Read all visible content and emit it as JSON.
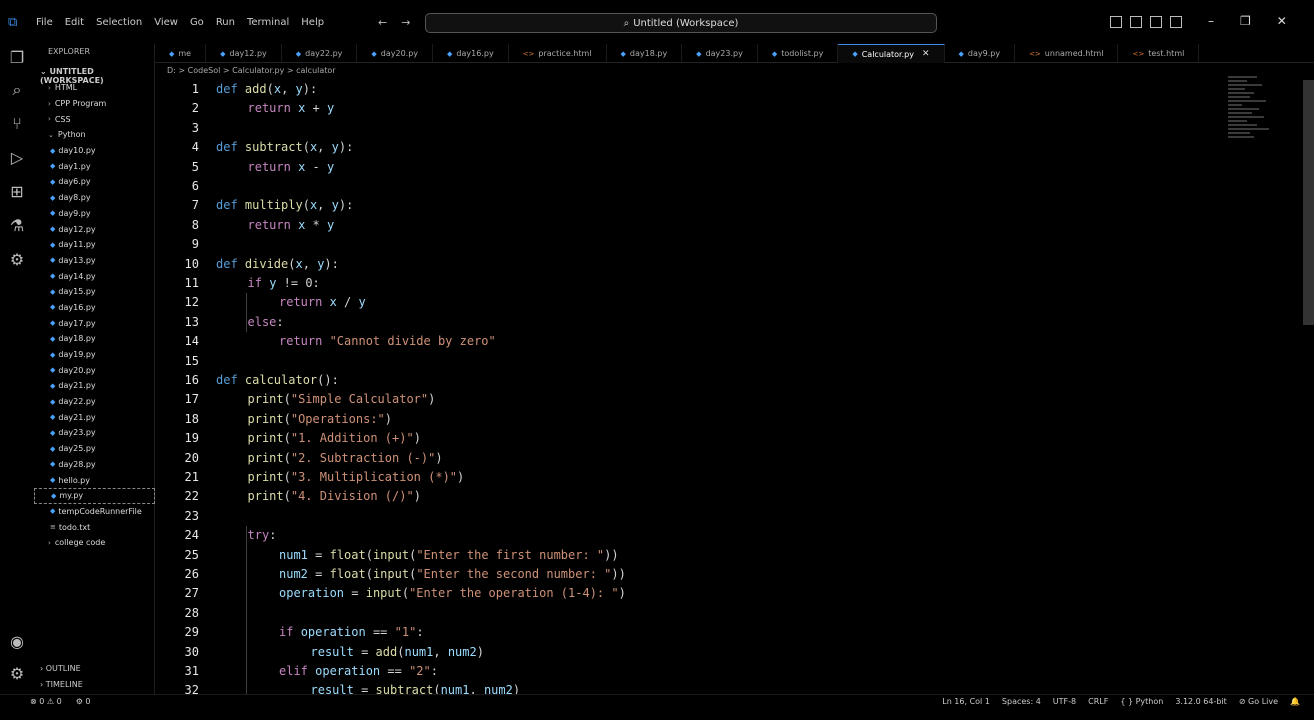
{
  "titlebar": {
    "menu": [
      "File",
      "Edit",
      "Selection",
      "View",
      "Go",
      "Run",
      "Terminal",
      "Help"
    ],
    "search_text": "Untitled (Workspace)"
  },
  "sidebar": {
    "header": "EXPLORER",
    "workspace": "UNTITLED (WORKSPACE)",
    "items": [
      {
        "label": "HTML",
        "type": "folder"
      },
      {
        "label": "CPP Program",
        "type": "folder"
      },
      {
        "label": "CSS",
        "type": "folder"
      },
      {
        "label": "Python",
        "type": "folder-open"
      },
      {
        "label": "day10.py",
        "type": "py"
      },
      {
        "label": "day1.py",
        "type": "py"
      },
      {
        "label": "day6.py",
        "type": "py"
      },
      {
        "label": "day8.py",
        "type": "py"
      },
      {
        "label": "day9.py",
        "type": "py"
      },
      {
        "label": "day12.py",
        "type": "py"
      },
      {
        "label": "day11.py",
        "type": "py"
      },
      {
        "label": "day13.py",
        "type": "py"
      },
      {
        "label": "day14.py",
        "type": "py"
      },
      {
        "label": "day15.py",
        "type": "py"
      },
      {
        "label": "day16.py",
        "type": "py"
      },
      {
        "label": "day17.py",
        "type": "py"
      },
      {
        "label": "day18.py",
        "type": "py"
      },
      {
        "label": "day19.py",
        "type": "py"
      },
      {
        "label": "day20.py",
        "type": "py"
      },
      {
        "label": "day21.py",
        "type": "py"
      },
      {
        "label": "day22.py",
        "type": "py"
      },
      {
        "label": "day21.py",
        "type": "py"
      },
      {
        "label": "day23.py",
        "type": "py"
      },
      {
        "label": "day25.py",
        "type": "py"
      },
      {
        "label": "day28.py",
        "type": "py"
      },
      {
        "label": "hello.py",
        "type": "py"
      },
      {
        "label": "my.py",
        "type": "py"
      },
      {
        "label": "tempCodeRunnerFile",
        "type": "py"
      },
      {
        "label": "todo.txt",
        "type": "file"
      },
      {
        "label": "college code",
        "type": "folder"
      }
    ],
    "outline": "OUTLINE",
    "timeline": "TIMELINE"
  },
  "tabs": [
    {
      "label": "me"
    },
    {
      "label": "day12.py"
    },
    {
      "label": "day22.py"
    },
    {
      "label": "day20.py"
    },
    {
      "label": "day16.py"
    },
    {
      "label": "practice.html"
    },
    {
      "label": "day18.py"
    },
    {
      "label": "day23.py"
    },
    {
      "label": "todolist.py"
    },
    {
      "label": "Calculator.py",
      "active": true
    },
    {
      "label": "day9.py"
    },
    {
      "label": "unnamed.html"
    },
    {
      "label": "test.html"
    }
  ],
  "breadcrumb": "D: > CodeSol > Calculator.py > calculator",
  "editor": {
    "lines": [
      {
        "n": "1",
        "indent": 0,
        "html": [
          [
            "kw",
            "def "
          ],
          [
            "fn",
            "add"
          ],
          [
            "txt",
            "("
          ],
          [
            "var",
            "x"
          ],
          [
            "txt",
            ", "
          ],
          [
            "var",
            "y"
          ],
          [
            "txt",
            "):"
          ]
        ]
      },
      {
        "n": "2",
        "indent": 1,
        "html": [
          [
            "kw2",
            "return "
          ],
          [
            "var",
            "x"
          ],
          [
            "txt",
            " + "
          ],
          [
            "var",
            "y"
          ]
        ]
      },
      {
        "n": "3",
        "indent": 0,
        "html": []
      },
      {
        "n": "4",
        "indent": 0,
        "html": [
          [
            "kw",
            "def "
          ],
          [
            "fn",
            "subtract"
          ],
          [
            "txt",
            "("
          ],
          [
            "var",
            "x"
          ],
          [
            "txt",
            ", "
          ],
          [
            "var",
            "y"
          ],
          [
            "txt",
            "):"
          ]
        ]
      },
      {
        "n": "5",
        "indent": 1,
        "html": [
          [
            "kw2",
            "return "
          ],
          [
            "var",
            "x"
          ],
          [
            "txt",
            " - "
          ],
          [
            "var",
            "y"
          ]
        ]
      },
      {
        "n": "6",
        "indent": 0,
        "html": []
      },
      {
        "n": "7",
        "indent": 0,
        "html": [
          [
            "kw",
            "def "
          ],
          [
            "fn",
            "multiply"
          ],
          [
            "txt",
            "("
          ],
          [
            "var",
            "x"
          ],
          [
            "txt",
            ", "
          ],
          [
            "var",
            "y"
          ],
          [
            "txt",
            "):"
          ]
        ]
      },
      {
        "n": "8",
        "indent": 1,
        "html": [
          [
            "kw2",
            "return "
          ],
          [
            "var",
            "x"
          ],
          [
            "txt",
            " * "
          ],
          [
            "var",
            "y"
          ]
        ]
      },
      {
        "n": "9",
        "indent": 0,
        "html": []
      },
      {
        "n": "10",
        "indent": 0,
        "html": [
          [
            "kw",
            "def "
          ],
          [
            "fn",
            "divide"
          ],
          [
            "txt",
            "("
          ],
          [
            "var",
            "x"
          ],
          [
            "txt",
            ", "
          ],
          [
            "var",
            "y"
          ],
          [
            "txt",
            "):"
          ]
        ]
      },
      {
        "n": "11",
        "indent": 1,
        "html": [
          [
            "kw2",
            "if "
          ],
          [
            "var",
            "y"
          ],
          [
            "txt",
            " != "
          ],
          [
            "txt",
            "0:"
          ]
        ]
      },
      {
        "n": "12",
        "indent": 2,
        "html": [
          [
            "kw2",
            "return "
          ],
          [
            "var",
            "x"
          ],
          [
            "txt",
            " / "
          ],
          [
            "var",
            "y"
          ]
        ]
      },
      {
        "n": "13",
        "indent": 1,
        "html": [
          [
            "kw2",
            "else"
          ],
          [
            "txt",
            ":"
          ]
        ]
      },
      {
        "n": "14",
        "indent": 2,
        "html": [
          [
            "kw2",
            "return "
          ],
          [
            "str",
            "\"Cannot divide by zero\""
          ]
        ]
      },
      {
        "n": "15",
        "indent": 0,
        "html": []
      },
      {
        "n": "16",
        "indent": 0,
        "html": [
          [
            "kw",
            "def "
          ],
          [
            "fn",
            "calculator"
          ],
          [
            "txt",
            "():"
          ]
        ]
      },
      {
        "n": "17",
        "indent": 1,
        "html": [
          [
            "fn",
            "print"
          ],
          [
            "txt",
            "("
          ],
          [
            "str",
            "\"Simple Calculator\""
          ],
          [
            "txt",
            ")"
          ]
        ]
      },
      {
        "n": "18",
        "indent": 1,
        "html": [
          [
            "fn",
            "print"
          ],
          [
            "txt",
            "("
          ],
          [
            "str",
            "\"Operations:\""
          ],
          [
            "txt",
            ")"
          ]
        ]
      },
      {
        "n": "19",
        "indent": 1,
        "html": [
          [
            "fn",
            "print"
          ],
          [
            "txt",
            "("
          ],
          [
            "str",
            "\"1. Addition (+)\""
          ],
          [
            "txt",
            ")"
          ]
        ]
      },
      {
        "n": "20",
        "indent": 1,
        "html": [
          [
            "fn",
            "print"
          ],
          [
            "txt",
            "("
          ],
          [
            "str",
            "\"2. Subtraction (-)\""
          ],
          [
            "txt",
            ")"
          ]
        ]
      },
      {
        "n": "21",
        "indent": 1,
        "html": [
          [
            "fn",
            "print"
          ],
          [
            "txt",
            "("
          ],
          [
            "str",
            "\"3. Multiplication (*)\""
          ],
          [
            "txt",
            ")"
          ]
        ]
      },
      {
        "n": "22",
        "indent": 1,
        "html": [
          [
            "fn",
            "print"
          ],
          [
            "txt",
            "("
          ],
          [
            "str",
            "\"4. Division (/)\""
          ],
          [
            "txt",
            ")"
          ]
        ]
      },
      {
        "n": "23",
        "indent": 0,
        "html": []
      },
      {
        "n": "24",
        "indent": 1,
        "html": [
          [
            "kw2",
            "try"
          ],
          [
            "txt",
            ":"
          ]
        ]
      },
      {
        "n": "25",
        "indent": 2,
        "html": [
          [
            "var",
            "num1"
          ],
          [
            "txt",
            " = "
          ],
          [
            "fn",
            "float"
          ],
          [
            "txt",
            "("
          ],
          [
            "fn",
            "input"
          ],
          [
            "txt",
            "("
          ],
          [
            "str",
            "\"Enter the first number: \""
          ],
          [
            "txt",
            "))"
          ]
        ]
      },
      {
        "n": "26",
        "indent": 2,
        "html": [
          [
            "var",
            "num2"
          ],
          [
            "txt",
            " = "
          ],
          [
            "fn",
            "float"
          ],
          [
            "txt",
            "("
          ],
          [
            "fn",
            "input"
          ],
          [
            "txt",
            "("
          ],
          [
            "str",
            "\"Enter the second number: \""
          ],
          [
            "txt",
            "))"
          ]
        ]
      },
      {
        "n": "27",
        "indent": 2,
        "html": [
          [
            "var",
            "operation"
          ],
          [
            "txt",
            " = "
          ],
          [
            "fn",
            "input"
          ],
          [
            "txt",
            "("
          ],
          [
            "str",
            "\"Enter the operation (1-4): \""
          ],
          [
            "txt",
            ")"
          ]
        ]
      },
      {
        "n": "28",
        "indent": 0,
        "html": []
      },
      {
        "n": "29",
        "indent": 2,
        "html": [
          [
            "kw2",
            "if "
          ],
          [
            "var",
            "operation"
          ],
          [
            "txt",
            " == "
          ],
          [
            "str",
            "\"1\""
          ],
          [
            "txt",
            ":"
          ]
        ]
      },
      {
        "n": "30",
        "indent": 3,
        "html": [
          [
            "var",
            "result"
          ],
          [
            "txt",
            " = "
          ],
          [
            "fn",
            "add"
          ],
          [
            "txt",
            "("
          ],
          [
            "var",
            "num1"
          ],
          [
            "txt",
            ", "
          ],
          [
            "var",
            "num2"
          ],
          [
            "txt",
            ")"
          ]
        ]
      },
      {
        "n": "31",
        "indent": 2,
        "html": [
          [
            "kw2",
            "elif "
          ],
          [
            "var",
            "operation"
          ],
          [
            "txt",
            " == "
          ],
          [
            "str",
            "\"2\""
          ],
          [
            "txt",
            ":"
          ]
        ]
      },
      {
        "n": "32",
        "indent": 3,
        "html": [
          [
            "var",
            "result"
          ],
          [
            "txt",
            " = "
          ],
          [
            "fn",
            "subtract"
          ],
          [
            "txt",
            "("
          ],
          [
            "var",
            "num1"
          ],
          [
            "txt",
            ", "
          ],
          [
            "var",
            "num2"
          ],
          [
            "txt",
            ")"
          ]
        ]
      }
    ]
  },
  "statusbar": {
    "left": [
      "⊗ 0 ⚠ 0",
      "⚙ 0"
    ],
    "right": [
      "Ln 16, Col 1",
      "Spaces: 4",
      "UTF-8",
      "CRLF",
      "{ } Python",
      "3.12.0 64-bit",
      "⊘ Go Live",
      "🔔"
    ]
  }
}
